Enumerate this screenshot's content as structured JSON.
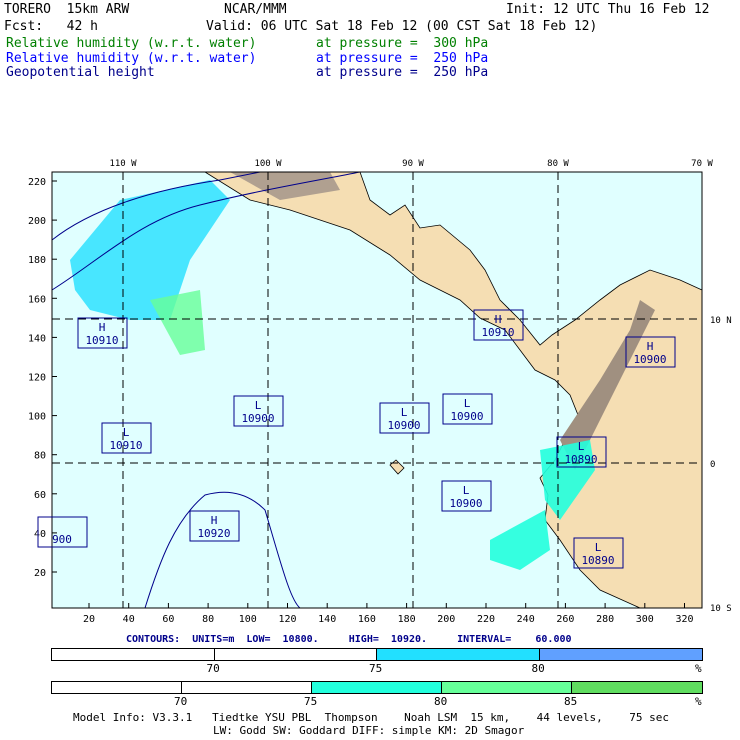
{
  "header": {
    "model": "TORERO  15km ARW",
    "org": "NCAR/MMM",
    "init": "Init: 12 UTC Thu 16 Feb 12",
    "fcst": "Fcst:   42 h",
    "valid": "Valid: 06 UTC Sat 18 Feb 12 (00 CST Sat 18 Feb 12)"
  },
  "fields": [
    {
      "name": "Relative humidity (w.r.t. water)",
      "level": "at pressure =  300 hPa",
      "color": "#008000"
    },
    {
      "name": "Relative humidity (w.r.t. water)",
      "level": "at pressure =  250 hPa",
      "color": "#0000ff"
    },
    {
      "name": "Geopotential height",
      "level": "at pressure =  250 hPa",
      "color": "#00008b"
    }
  ],
  "map": {
    "lon_labels": [
      "110 W",
      "100 W",
      "90 W",
      "80 W",
      "70 W"
    ],
    "lat_labels": [
      "10 N",
      "0",
      "10 S"
    ],
    "x_ticks": [
      "20",
      "40",
      "60",
      "80",
      "100",
      "120",
      "140",
      "160",
      "180",
      "200",
      "220",
      "240",
      "260",
      "280",
      "300",
      "320"
    ],
    "y_ticks": [
      "20",
      "40",
      "60",
      "80",
      "100",
      "120",
      "140",
      "160",
      "180",
      "200",
      "220"
    ],
    "centers": [
      {
        "type": "H",
        "value": "10910"
      },
      {
        "type": "H",
        "value": "10910"
      },
      {
        "type": "H",
        "value": "10900"
      },
      {
        "type": "L",
        "value": "10900"
      },
      {
        "type": "L",
        "value": "10900"
      },
      {
        "type": "L",
        "value": "10900"
      },
      {
        "type": "L",
        "value": "10910"
      },
      {
        "type": "L",
        "value": "10890"
      },
      {
        "type": "L",
        "value": "10900"
      },
      {
        "type": "H",
        "value": "10920"
      },
      {
        "type": "L",
        "value": "10890"
      },
      {
        "type": "",
        "value": "900"
      }
    ]
  },
  "contours": "CONTOURS:  UNITS=m  LOW=  10800.     HIGH=  10920.     INTERVAL=    60.000",
  "legend1": {
    "labels": [
      "70",
      "75",
      "80",
      "%"
    ],
    "colors": [
      "#ffffff",
      "#ffffff",
      "#22e0ff",
      "#60a0ff"
    ]
  },
  "legend2": {
    "labels": [
      "70",
      "75",
      "80",
      "85",
      "%"
    ],
    "colors": [
      "#ffffff",
      "#ffffff",
      "#22ffdd",
      "#66ff99",
      "#60dd60"
    ]
  },
  "footer": {
    "line1": "Model Info: V3.3.1   Tiedtke YSU PBL  Thompson    Noah LSM  15 km,    44 levels,    75 sec",
    "line2": "LW: Godd SW: Goddard DIFF: simple KM: 2D Smagor"
  }
}
